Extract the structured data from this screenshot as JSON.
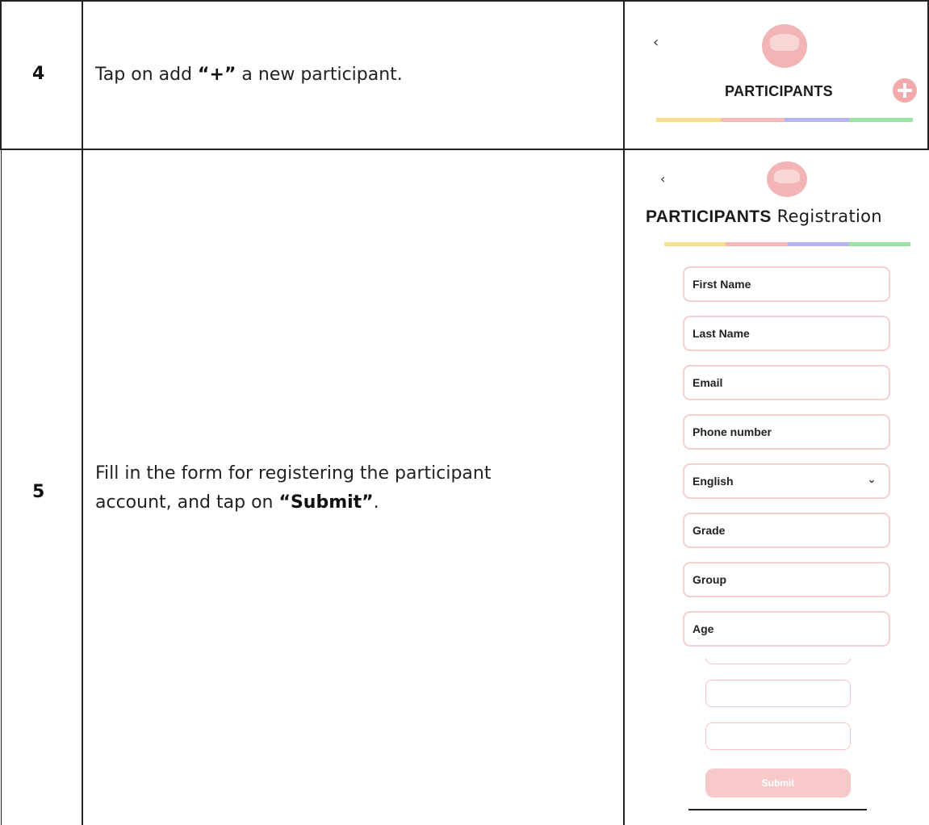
{
  "rows": [
    {
      "step": "4",
      "instruction": {
        "before": "Tap on add ",
        "bold": "“+”",
        "after": " a new participant."
      },
      "screen": {
        "back": "‹",
        "title": "PARTICIPANTS"
      }
    },
    {
      "step": "5",
      "instruction": {
        "line1": "Fill in the form for registering the participant",
        "line2_before": "account, and tap on ",
        "bold": "“Submit”",
        "line2_after": "."
      },
      "screen": {
        "back": "‹",
        "title_bold": "PARTICIPANTS",
        "title_light": " Registration",
        "fields": [
          "First Name",
          "Last Name",
          "Email",
          "Phone number",
          "English",
          "Grade",
          "Group",
          "Age"
        ],
        "submit_label": "Submit"
      }
    }
  ],
  "colors": {
    "bar": [
      "#f6e08c",
      "#f4b9b9",
      "#b4b4f0",
      "#9ee3a4"
    ],
    "accent": "#f3a9a9",
    "field_border": "#f6cfcf"
  },
  "icons": {
    "back": "chevron-left-icon",
    "add": "plus-circle-icon",
    "dropdown": "chevron-down-icon",
    "logo": "app-logo"
  }
}
